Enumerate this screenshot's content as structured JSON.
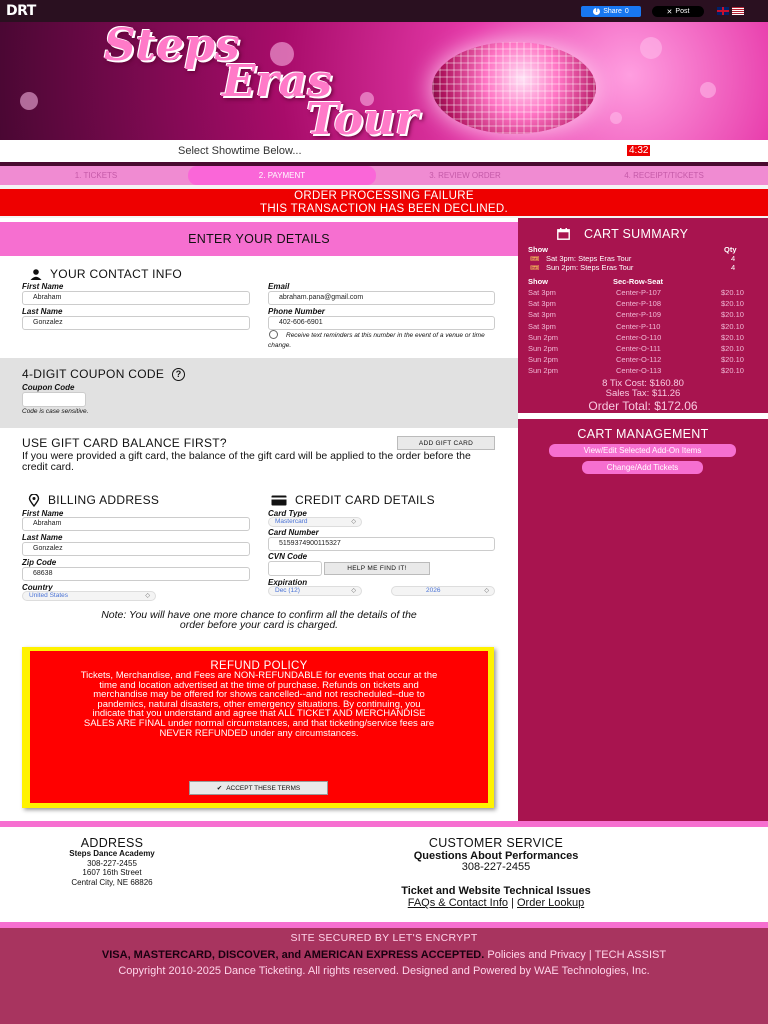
{
  "header": {
    "logo": "DRT",
    "share_label": "Share",
    "share_count": "0",
    "post_label": "Post"
  },
  "banner": {
    "title_line1": "Steps",
    "title_line2": "Eras",
    "title_line3": "Tour"
  },
  "showtime": {
    "label": "Select Showtime Below...",
    "timer": "4:32"
  },
  "steps": [
    {
      "label": "1. TICKETS"
    },
    {
      "label": "2. PAYMENT"
    },
    {
      "label": "3. REVIEW ORDER"
    },
    {
      "label": "4. RECEIPT/TICKETS"
    }
  ],
  "error": {
    "line1": "ORDER PROCESSING FAILURE",
    "line2": "THIS TRANSACTION HAS BEEN DECLINED."
  },
  "details": {
    "header": "ENTER YOUR DETAILS",
    "contact_title": "YOUR CONTACT INFO",
    "first_name_label": "First Name",
    "first_name": "Abraham",
    "last_name_label": "Last Name",
    "last_name": "Gonzalez",
    "email_label": "Email",
    "email": "abraham.pana@gmail.com",
    "phone_label": "Phone Number",
    "phone": "402-606-6901",
    "sms_note": "Receive text reminders at this number in the event of a venue or time change."
  },
  "coupon": {
    "title": "4-DIGIT COUPON CODE",
    "label": "Coupon Code",
    "value": "",
    "note": "Code is case sensitive."
  },
  "gift": {
    "title": "USE GIFT CARD BALANCE FIRST?",
    "button": "ADD GIFT CARD",
    "text": "If you were provided a gift card, the balance of the gift card will be applied to the order before the credit card."
  },
  "billing": {
    "title": "BILLING ADDRESS",
    "first_name_label": "First Name",
    "first_name": "Abraham",
    "last_name_label": "Last Name",
    "last_name": "Gonzalez",
    "zip_label": "Zip Code",
    "zip": "68638",
    "country_label": "Country",
    "country": "United States"
  },
  "card": {
    "title": "CREDIT CARD DETAILS",
    "type_label": "Card Type",
    "type": "Mastercard",
    "number_label": "Card Number",
    "number": "5159374900115327",
    "cvn_label": "CVN Code",
    "cvn": "",
    "help_button": "HELP ME FIND IT!",
    "expiration_label": "Expiration",
    "exp_month": "Dec (12)",
    "exp_year": "2026"
  },
  "confirm_note": "Note: You will have one more chance to confirm all the details of the order before your card is charged.",
  "refund": {
    "title": "REFUND POLICY",
    "body": "Tickets, Merchandise, and Fees are NON-REFUNDABLE for events that occur at the time and location advertised at the time of purchase. Refunds on tickets and merchandise may be offered for shows cancelled--and not rescheduled--due to pandemics, natural disasters, other emergency situations. By continuing, you indicate that you understand and agree that ALL TICKET AND MERCHANDISE SALES ARE FINAL under normal circumstances, and that ticketing/service fees are NEVER REFUNDED under any circumstances.",
    "button": "ACCEPT THESE TERMS"
  },
  "cart": {
    "title": "CART SUMMARY",
    "show_header": "Show",
    "qty_header": "Qty",
    "shows": [
      {
        "name": "Sat 3pm: Steps Eras Tour",
        "qty": "4"
      },
      {
        "name": "Sun 2pm: Steps Eras Tour",
        "qty": "4"
      }
    ],
    "seat_show_header": "Show",
    "seat_header": "Sec-Row-Seat",
    "seats": [
      {
        "show": "Sat 3pm",
        "seat": "Center-P-107",
        "price": "$20.10"
      },
      {
        "show": "Sat 3pm",
        "seat": "Center-P-108",
        "price": "$20.10"
      },
      {
        "show": "Sat 3pm",
        "seat": "Center-P-109",
        "price": "$20.10"
      },
      {
        "show": "Sat 3pm",
        "seat": "Center-P-110",
        "price": "$20.10"
      },
      {
        "show": "Sun 2pm",
        "seat": "Center-O-110",
        "price": "$20.10"
      },
      {
        "show": "Sun 2pm",
        "seat": "Center-O-111",
        "price": "$20.10"
      },
      {
        "show": "Sun 2pm",
        "seat": "Center-O-112",
        "price": "$20.10"
      },
      {
        "show": "Sun 2pm",
        "seat": "Center-O-113",
        "price": "$20.10"
      }
    ],
    "tix_cost": "8 Tix Cost: $160.80",
    "sales_tax": "Sales Tax: $11.26",
    "order_total": "Order Total: $172.06"
  },
  "cart_mgmt": {
    "title": "CART MANAGEMENT",
    "button1": "View/Edit Selected Add-On Items",
    "button2": "Change/Add Tickets"
  },
  "footer": {
    "address_title": "ADDRESS",
    "org": "Steps Dance Academy",
    "phone": "308-227-2455",
    "street": "1607 16th Street",
    "city": "Central City, NE 68826",
    "cs_title": "CUSTOMER SERVICE",
    "cs_sub1": "Questions About Performances",
    "cs_phone": "308-227-2455",
    "cs_sub2": "Ticket and Website Technical Issues",
    "faq_link": "FAQs & Contact Info",
    "sep": "|",
    "lookup_link": "Order Lookup",
    "secured": "SITE SECURED BY LET'S ENCRYPT",
    "cards_accepted": "VISA, MASTERCARD, DISCOVER, and AMERICAN EXPRESS ACCEPTED.",
    "policies": "Policies and Privacy",
    "tech_assist": "TECH ASSIST",
    "copyright": "Copyright 2010-2025 Dance Ticketing. All rights reserved. Designed and Powered by WAE Technologies, Inc."
  },
  "colors": {
    "accent_pink": "#f66fd0",
    "sidebar": "#a8144f",
    "error_red": "#ff0000"
  }
}
